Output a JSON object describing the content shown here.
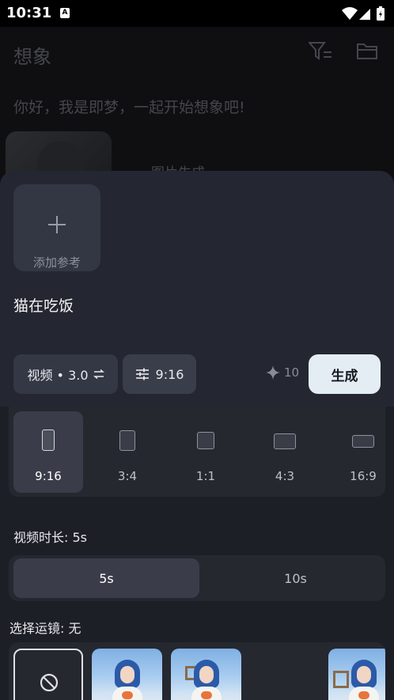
{
  "status": {
    "time": "10:31",
    "badge": "A"
  },
  "background": {
    "title": "想象",
    "greeting": "你好，我是即梦，一起开始想象吧!",
    "card_label": "图片生成"
  },
  "sheet": {
    "add_reference_label": "添加参考",
    "prompt": "猫在吃饭",
    "model_label": "视频 • 3.0",
    "ratio_button_label": "9:16",
    "credits": "10",
    "generate_label": "生成",
    "ratios": [
      {
        "label": "9:16",
        "selected": true
      },
      {
        "label": "3:4",
        "selected": false
      },
      {
        "label": "1:1",
        "selected": false
      },
      {
        "label": "4:3",
        "selected": false
      },
      {
        "label": "16:9",
        "selected": false
      }
    ],
    "duration_label": "视频时长: 5s",
    "durations": [
      {
        "label": "5s",
        "selected": true
      },
      {
        "label": "10s",
        "selected": false
      }
    ],
    "camera_label": "选择运镜: 无"
  },
  "colors": {
    "accent_button": "#e3edf3",
    "sheet_bg": "#1d1f26"
  }
}
